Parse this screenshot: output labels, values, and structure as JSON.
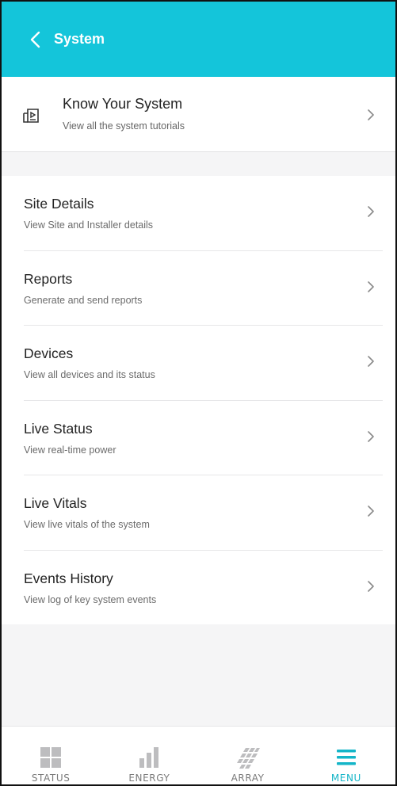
{
  "header": {
    "title": "System"
  },
  "know_system": {
    "title": "Know Your System",
    "subtitle": "View all the system tutorials"
  },
  "menu_items": [
    {
      "title": "Site Details",
      "subtitle": "View Site and Installer details"
    },
    {
      "title": "Reports",
      "subtitle": "Generate and send reports"
    },
    {
      "title": "Devices",
      "subtitle": "View all devices and its status"
    },
    {
      "title": "Live Status",
      "subtitle": "View real-time power"
    },
    {
      "title": "Live Vitals",
      "subtitle": "View live vitals of the system"
    },
    {
      "title": "Events History",
      "subtitle": "View log of key system events"
    }
  ],
  "tabbar": {
    "tabs": [
      {
        "label": "STATUS",
        "icon": "status-icon",
        "active": false
      },
      {
        "label": "ENERGY",
        "icon": "energy-icon",
        "active": false
      },
      {
        "label": "ARRAY",
        "icon": "array-icon",
        "active": false
      },
      {
        "label": "MENU",
        "icon": "menu-icon",
        "active": true
      }
    ]
  },
  "colors": {
    "accent": "#14c5da",
    "tab_active": "#14b5c8",
    "tab_inactive": "#b9b9bb"
  }
}
